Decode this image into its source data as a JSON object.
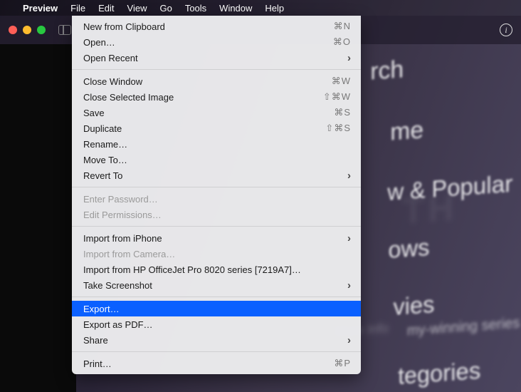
{
  "menubar": {
    "app_name": "Preview",
    "items": [
      "File",
      "Edit",
      "View",
      "Go",
      "Tools",
      "Window",
      "Help"
    ],
    "active_index": 0
  },
  "background_words": {
    "t1": "rch",
    "t2": "me",
    "t3": "w & Popular",
    "t4": "ows",
    "t5": "vies",
    "t6": "my-winning series",
    "t7": "tegories",
    "t8": "More Info",
    "ghost": "TH"
  },
  "file_menu": {
    "groups": [
      [
        {
          "label": "New from Clipboard",
          "shortcut": "⌘N",
          "enabled": true
        },
        {
          "label": "Open…",
          "shortcut": "⌘O",
          "enabled": true
        },
        {
          "label": "Open Recent",
          "submenu": true,
          "enabled": true
        }
      ],
      [
        {
          "label": "Close Window",
          "shortcut": "⌘W",
          "enabled": true
        },
        {
          "label": "Close Selected Image",
          "shortcut": "⇧⌘W",
          "enabled": true
        },
        {
          "label": "Save",
          "shortcut": "⌘S",
          "enabled": true
        },
        {
          "label": "Duplicate",
          "shortcut": "⇧⌘S",
          "enabled": true
        },
        {
          "label": "Rename…",
          "enabled": true
        },
        {
          "label": "Move To…",
          "enabled": true
        },
        {
          "label": "Revert To",
          "submenu": true,
          "enabled": true
        }
      ],
      [
        {
          "label": "Enter Password…",
          "enabled": false
        },
        {
          "label": "Edit Permissions…",
          "enabled": false
        }
      ],
      [
        {
          "label": "Import from iPhone",
          "submenu": true,
          "enabled": true
        },
        {
          "label": "Import from Camera…",
          "enabled": false
        },
        {
          "label": "Import from HP OfficeJet Pro 8020 series [7219A7]…",
          "enabled": true
        },
        {
          "label": "Take Screenshot",
          "submenu": true,
          "enabled": true
        }
      ],
      [
        {
          "label": "Export…",
          "enabled": true,
          "selected": true
        },
        {
          "label": "Export as PDF…",
          "enabled": true
        },
        {
          "label": "Share",
          "submenu": true,
          "enabled": true
        }
      ],
      [
        {
          "label": "Print…",
          "shortcut": "⌘P",
          "enabled": true
        }
      ]
    ]
  }
}
